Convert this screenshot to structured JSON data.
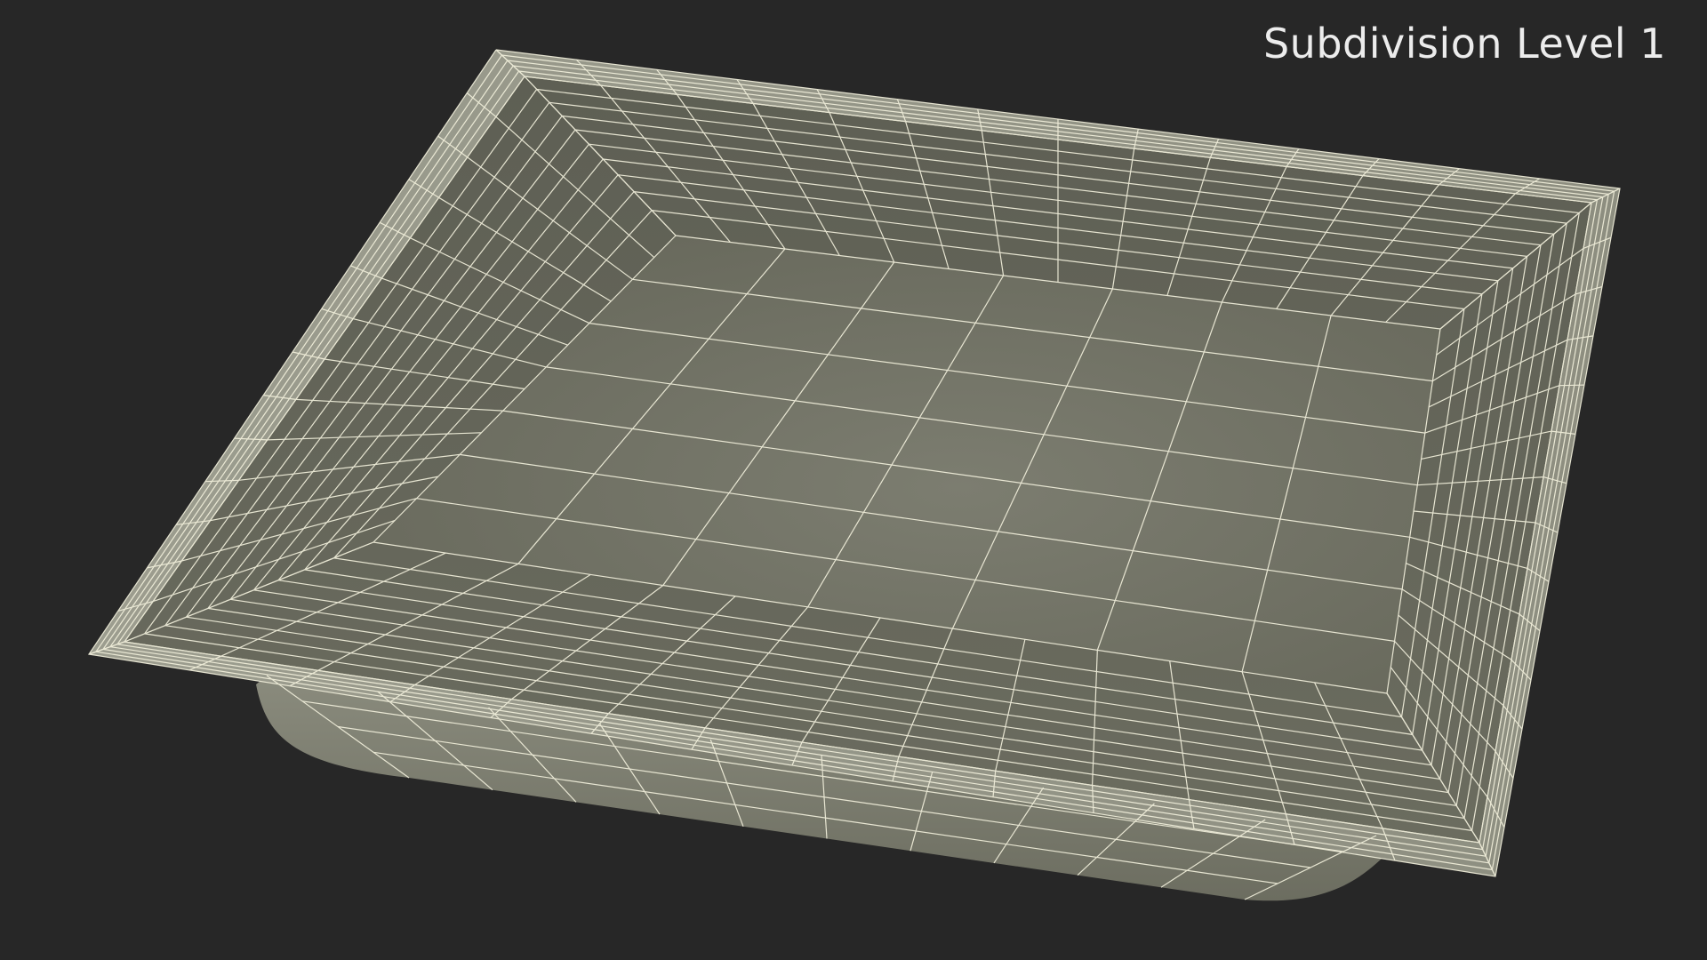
{
  "viewport": {
    "label": "Subdivision Level 1",
    "background_color": "#272727"
  },
  "model": {
    "description_icon": "tray-wireframe",
    "surface_color": "#737466",
    "wire_color": "#f2f0dc"
  }
}
